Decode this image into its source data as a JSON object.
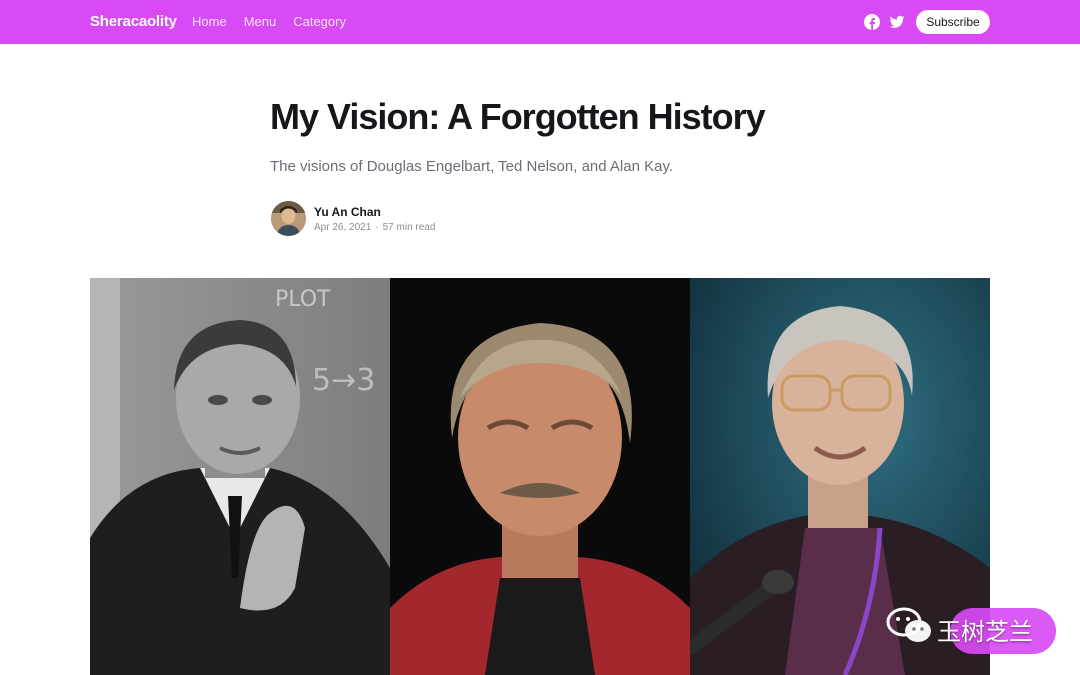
{
  "header": {
    "brand": "Sheracaolity",
    "nav": [
      {
        "label": "Home"
      },
      {
        "label": "Menu"
      },
      {
        "label": "Category"
      }
    ],
    "social": [
      "facebook-icon",
      "twitter-icon"
    ],
    "subscribe_label": "Subscribe",
    "accent_color": "#d84bf4"
  },
  "article": {
    "title": "My Vision: A Forgotten History",
    "subtitle": "The visions of Douglas Engelbart, Ted Nelson, and Alan Kay.",
    "author": "Yu An Chan",
    "date": "Apr 26, 2021",
    "read_time": "57 min read"
  },
  "feature_image": {
    "panels": [
      "black-and-white-portrait",
      "color-portrait",
      "color-portrait-with-microphone"
    ]
  },
  "watermark": {
    "icon": "wechat-icon",
    "text": "玉树芝兰"
  }
}
